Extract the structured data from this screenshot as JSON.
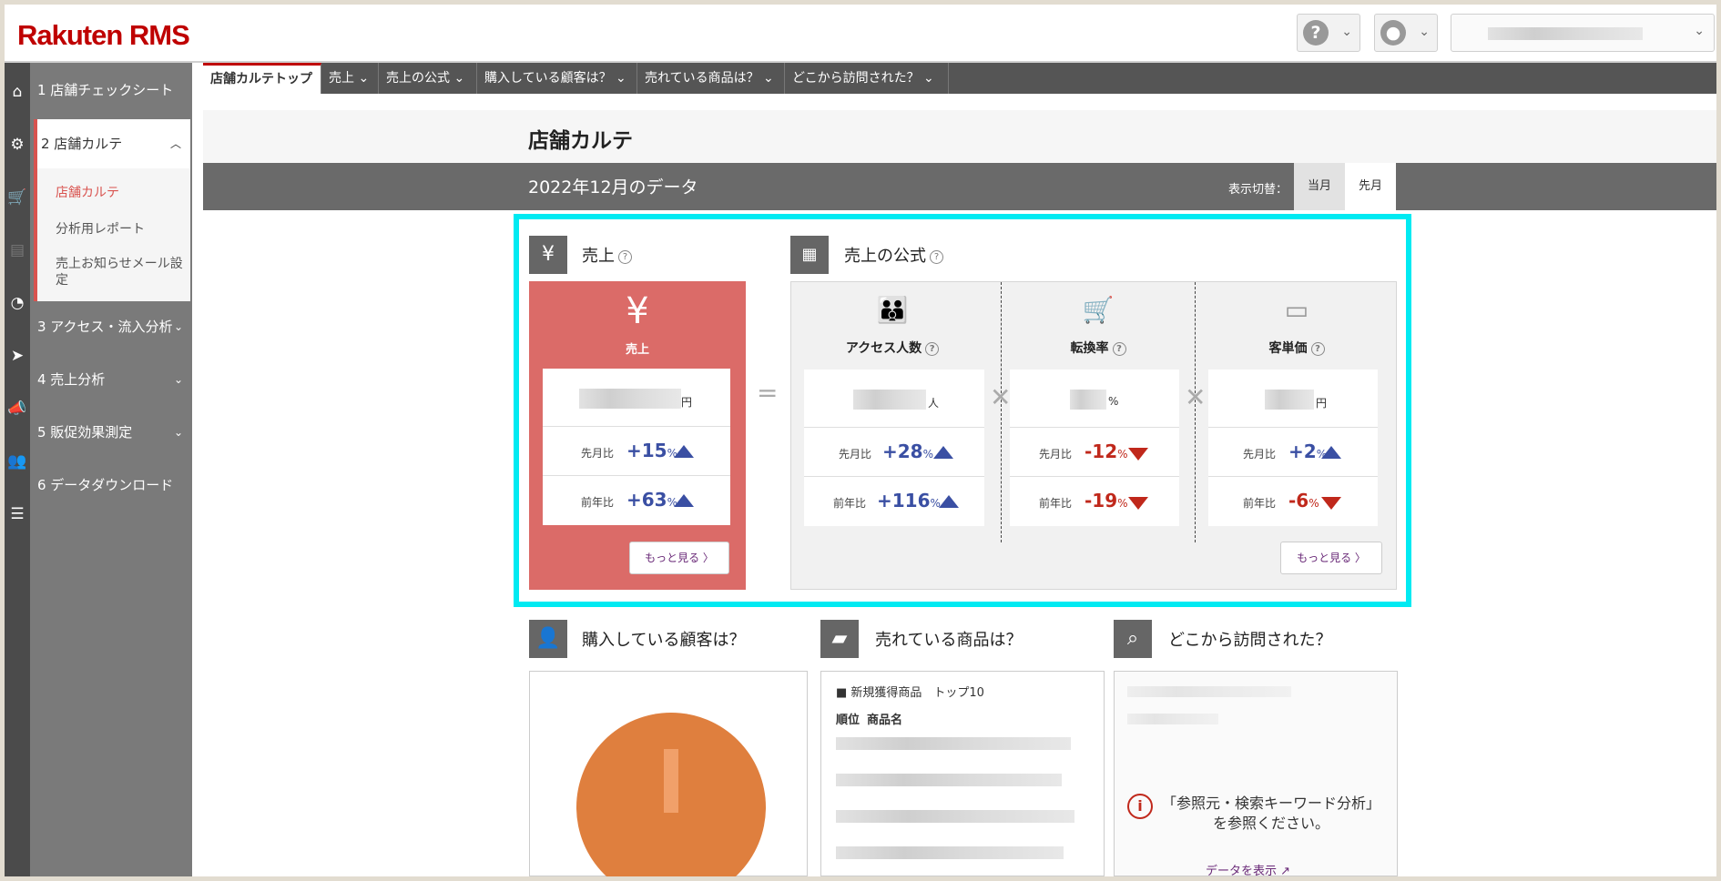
{
  "brand": {
    "logo": "Rakuten RMS",
    "accent": "#bf0000",
    "highlight": "#00eaf2"
  },
  "header": {
    "help_icon": "?",
    "user_icon": "user-icon"
  },
  "sidebar": {
    "items": [
      {
        "label": "1 店舗チェックシート"
      },
      {
        "label": "2 店舗カルテ"
      },
      {
        "label": "3 アクセス・流入分析"
      },
      {
        "label": "4 売上分析"
      },
      {
        "label": "5 販促効果測定"
      },
      {
        "label": "6 データダウンロード"
      }
    ],
    "sub_items": [
      {
        "label": "店舗カルテ"
      },
      {
        "label": "分析用レポート"
      },
      {
        "label": "売上お知らせメール設定"
      }
    ]
  },
  "tabs": [
    {
      "label": "店舗カルテトップ"
    },
    {
      "label": "売上"
    },
    {
      "label": "売上の公式"
    },
    {
      "label": "購入している顧客は？"
    },
    {
      "label": "売れている商品は？"
    },
    {
      "label": "どこから訪問された？"
    }
  ],
  "page": {
    "title": "店舗カルテ",
    "data_label": "2022年12月のデータ",
    "switch_label": "表示切替：",
    "btn_current": "当月",
    "btn_previous": "先月"
  },
  "sales": {
    "heading": "売上",
    "yen": "¥",
    "card_label": "売上",
    "unit": "円",
    "mom_label": "先月比",
    "mom_value": "+15",
    "yoy_label": "前年比",
    "yoy_value": "+63",
    "pct": "%",
    "more": "もっと見る 〉"
  },
  "formula": {
    "heading": "売上の公式",
    "more": "もっと見る 〉",
    "columns": [
      {
        "label": "アクセス人数",
        "unit": "人",
        "mom": "+28",
        "yoy": "+116",
        "mom_dir": "up",
        "yoy_dir": "up"
      },
      {
        "label": "転換率",
        "unit": "%",
        "mom": "-12",
        "yoy": "-19",
        "mom_dir": "down",
        "yoy_dir": "down"
      },
      {
        "label": "客単価",
        "unit": "円",
        "mom": "+2",
        "yoy": "-6",
        "mom_dir": "up",
        "yoy_dir": "down"
      }
    ],
    "mom_label": "先月比",
    "yoy_label": "前年比",
    "pct": "%"
  },
  "bottom": {
    "customers_heading": "購入している顧客は？",
    "products_heading": "売れている商品は？",
    "visits_heading": "どこから訪問された？",
    "products_subtitle": "■ 新規獲得商品　トップ10",
    "col_rank": "順位",
    "col_name": "商品名",
    "visits_notice": "「参照元・検索キーワード分析」を参照ください。",
    "visits_link": "データを表示"
  }
}
